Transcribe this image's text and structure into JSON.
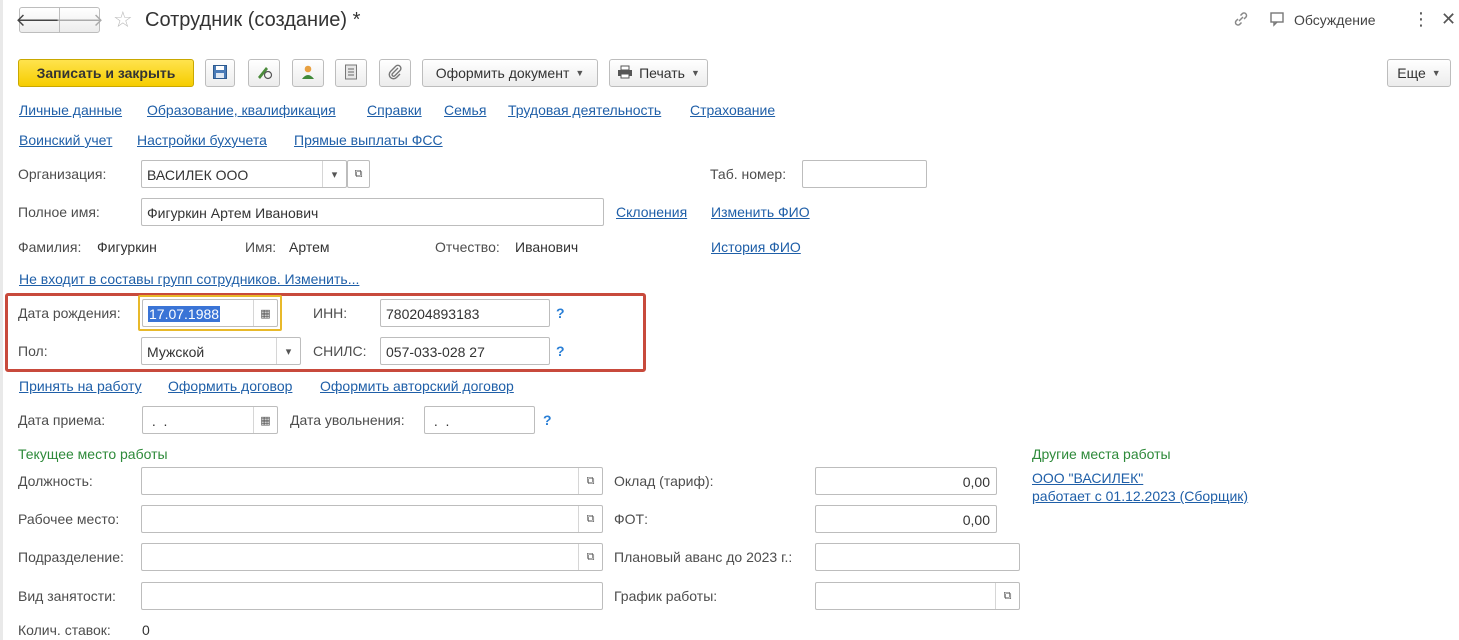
{
  "header": {
    "title": "Сотрудник (создание) *",
    "discussion_label": "Обсуждение"
  },
  "toolbar": {
    "save_close_label": "Записать и закрыть",
    "issue_document_label": "Оформить документ",
    "print_label": "Печать",
    "more_label": "Еще"
  },
  "nav_links": {
    "row1": [
      "Личные данные",
      "Образование, квалификация",
      "Справки",
      "Семья",
      "Трудовая деятельность",
      "Страхование"
    ],
    "row2": [
      "Воинский учет",
      "Настройки бухучета",
      "Прямые выплаты ФСС"
    ]
  },
  "form": {
    "organization_label": "Организация:",
    "organization_value": "ВАСИЛЕК ООО",
    "tab_number_label": "Таб. номер:",
    "tab_number_value": "",
    "full_name_label": "Полное имя:",
    "full_name_value": "Фигуркин Артем Иванович",
    "declensions_link": "Склонения",
    "change_name_link": "Изменить ФИО",
    "surname_label": "Фамилия:",
    "surname_value": "Фигуркин",
    "first_name_label": "Имя:",
    "first_name_value": "Артем",
    "patronymic_label": "Отчество:",
    "patronymic_value": "Иванович",
    "name_history_link": "История ФИО",
    "groups_link": "Не входит в составы групп сотрудников. Изменить...",
    "birth_date_label": "Дата рождения:",
    "birth_date_value": "17.07.1988",
    "inn_label": "ИНН:",
    "inn_value": "780204893183",
    "gender_label": "Пол:",
    "gender_value": "Мужской",
    "snils_label": "СНИЛС:",
    "snils_value": "057-033-028 27",
    "hire_link": "Принять на работу",
    "contract_link": "Оформить договор",
    "author_contract_link": "Оформить авторский договор",
    "hire_date_label": "Дата приема:",
    "hire_date_value": " .  .",
    "dismissal_date_label": "Дата увольнения:",
    "dismissal_date_value": " .  .",
    "current_workplace_section": "Текущее место работы",
    "position_label": "Должность:",
    "workplace_label": "Рабочее место:",
    "department_label": "Подразделение:",
    "employment_type_label": "Вид занятости:",
    "rate_count_label": "Колич. ставок:",
    "rate_count_value": "0",
    "salary_label": "Оклад (тариф):",
    "salary_value": "0,00",
    "fot_label": "ФОТ:",
    "fot_value": "0,00",
    "advance_label": "Плановый аванс до 2023 г.:",
    "schedule_label": "График работы:",
    "other_workplaces_section": "Другие места работы",
    "other_workplace_org": "ООО \"ВАСИЛЕК\"",
    "other_workplace_info": "работает с 01.12.2023 (Сборщик)"
  },
  "help_mark": "?",
  "colors": {
    "primary_button": "#f6cd00",
    "link": "#1f5fa8",
    "section": "#2e8a3a",
    "highlight_frame": "#c84a3c",
    "focus_frame": "#e8b92a"
  }
}
